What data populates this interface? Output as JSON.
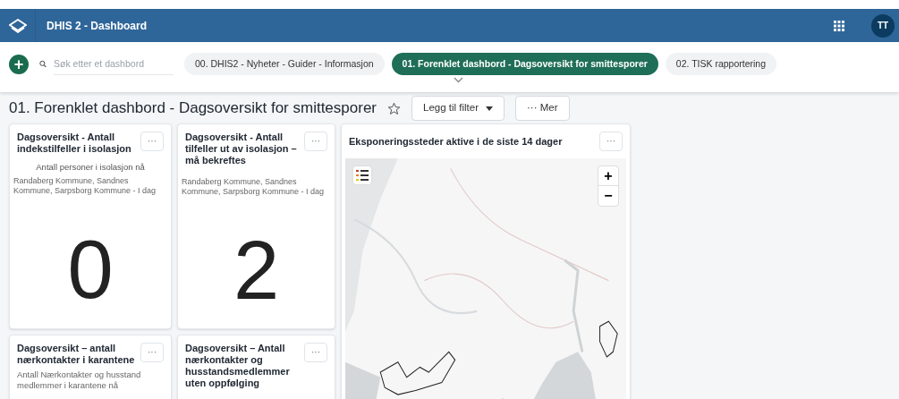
{
  "header": {
    "title": "DHIS 2 - Dashboard",
    "avatar": "TT"
  },
  "toolbar": {
    "add": "+",
    "search": {
      "placeholder": "Søk etter et dashbord"
    },
    "chips": [
      {
        "label": "00. DHIS2 - Nyheter - Guider - Informasjon",
        "selected": false
      },
      {
        "label": "01. Forenklet dashbord - Dagsoversikt for smittesporer",
        "selected": true
      },
      {
        "label": "02. TISK rapportering",
        "selected": false
      }
    ]
  },
  "dashboard": {
    "title": "01. Forenklet dashbord - Dagsoversikt for smittesporer",
    "starred": false,
    "filter_button": "Legg til filter",
    "more_button": "··· Mer"
  },
  "items": [
    {
      "kind": "value",
      "title": "Dagsoversikt - Antall indekstilfeller i isolasjon",
      "menu": "···",
      "subtitle": "Antall personer i isolasjon nå",
      "filter": "Randaberg Kommune, Sandnes Kommune, Sarpsborg Kommune - I dag",
      "value": "0"
    },
    {
      "kind": "value",
      "title": "Dagsoversikt - Antall tilfeller ut av isolasjon – må bekreftes",
      "menu": "···",
      "filter": "Randaberg Kommune, Sandnes Kommune, Sarpsborg Kommune - I dag",
      "value": "2"
    },
    {
      "kind": "map",
      "title": "Eksponeringssteder aktive i de siste 14 dager",
      "menu": "···",
      "zoom_in": "+",
      "zoom_out": "−"
    },
    {
      "kind": "text",
      "title": "Dagsoversikt – antall nærkontakter i karantene",
      "menu": "···",
      "subtitle": "Antall Nærkontakter og husstand medlemmer i karantene nå"
    },
    {
      "kind": "text",
      "title": "Dagsoversikt – Antall nærkontakter og husstandsmedlemmer uten oppfølging",
      "menu": "···"
    }
  ]
}
